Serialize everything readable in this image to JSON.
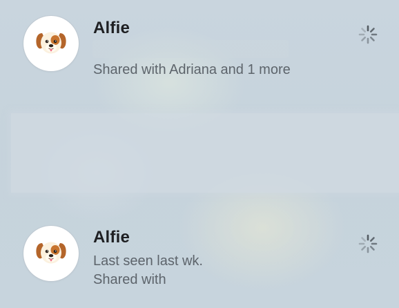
{
  "contacts": [
    {
      "name": "Alfie",
      "avatar_icon": "dog-face-emoji",
      "status_icon": "loading-spinner-icon",
      "line1": "Shared with Adriana and 1 more"
    },
    {
      "name": "Alfie",
      "avatar_icon": "dog-face-emoji",
      "status_icon": "loading-spinner-icon",
      "line1": "Last seen last wk.",
      "line2": "Shared with"
    }
  ],
  "colors": {
    "background": "#c7d4dd",
    "name_text": "#1e1f22",
    "secondary_text": "#5d646b",
    "dog_fur": "#c8742e",
    "dog_cream": "#fbf1df"
  }
}
